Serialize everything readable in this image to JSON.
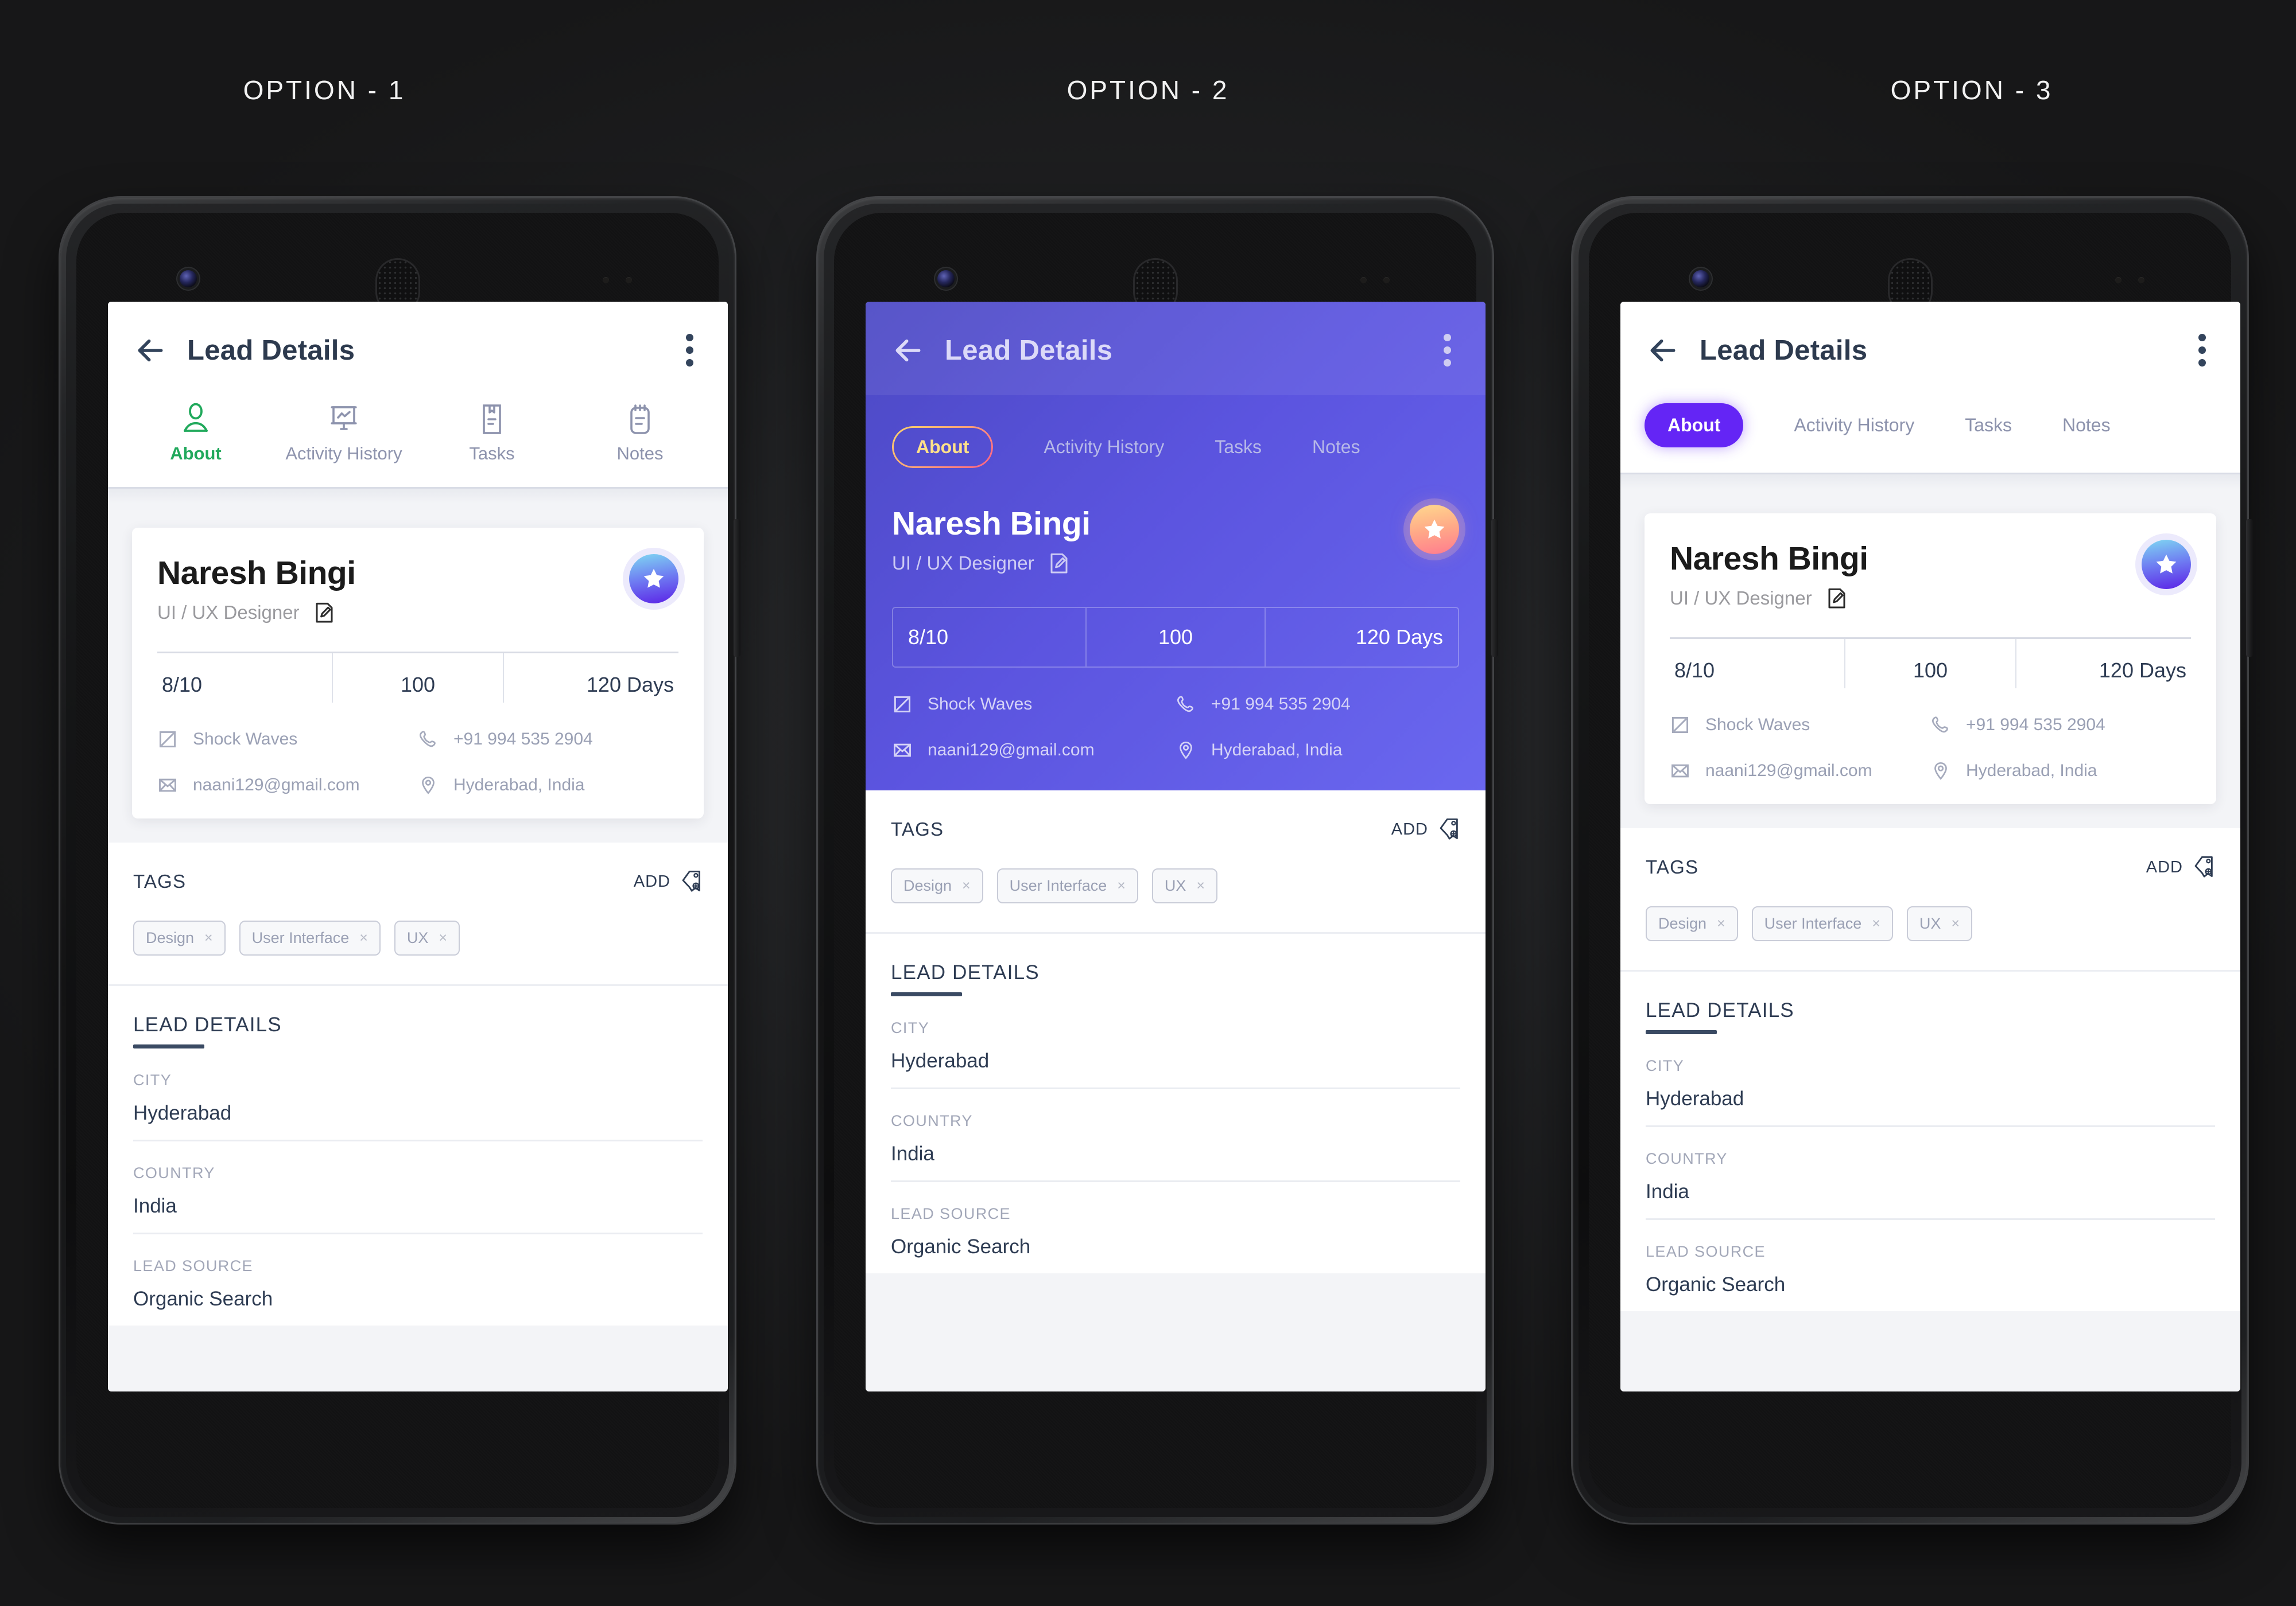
{
  "options": [
    {
      "title": "OPTION - 1"
    },
    {
      "title": "OPTION - 2"
    },
    {
      "title": "OPTION - 3"
    }
  ],
  "app": {
    "title": "Lead Details",
    "back_icon": "arrow-left-icon",
    "overflow_icon": "kebab-menu-icon"
  },
  "tabs": [
    {
      "label": "About",
      "icon": "person-icon",
      "active": true
    },
    {
      "label": "Activity History",
      "icon": "chart-board-icon",
      "active": false
    },
    {
      "label": "Tasks",
      "icon": "task-list-icon",
      "active": false
    },
    {
      "label": "Notes",
      "icon": "notes-icon",
      "active": false
    }
  ],
  "lead": {
    "name": "Naresh Bingi",
    "role": "UI / UX Designer",
    "edit_icon": "edit-pencil-icon",
    "favorite_icon": "star-icon",
    "stats": [
      {
        "value": "8/10"
      },
      {
        "value": "100"
      },
      {
        "value": "120 Days"
      }
    ],
    "contacts": [
      {
        "icon": "company-icon",
        "text": "Shock Waves"
      },
      {
        "icon": "phone-icon",
        "text": "+91 994 535 2904"
      },
      {
        "icon": "email-icon",
        "text": "naani129@gmail.com"
      },
      {
        "icon": "location-icon",
        "text": "Hyderabad, India"
      }
    ]
  },
  "tags": {
    "title": "TAGS",
    "add_label": "ADD",
    "add_icon": "tag-plus-icon",
    "items": [
      {
        "label": "Design",
        "remove_icon": "close-icon"
      },
      {
        "label": "User Interface",
        "remove_icon": "close-icon"
      },
      {
        "label": "UX",
        "remove_icon": "close-icon"
      }
    ]
  },
  "lead_details": {
    "title": "LEAD DETAILS",
    "rows": [
      {
        "key": "CITY",
        "value": "Hyderabad"
      },
      {
        "key": "COUNTRY",
        "value": "India"
      },
      {
        "key": "LEAD SOURCE",
        "value": "Organic Search"
      }
    ]
  },
  "colors": {
    "page_bg": "#1f2022",
    "accent_green": "#21a95c",
    "accent_purple": "#6425f5",
    "hero_purple_start": "#4c49c4",
    "hero_purple_end": "#6a67ef",
    "pill_gradient_start": "#ffd76a",
    "pill_gradient_end": "#ff5f86",
    "text_dark": "#2e3c53",
    "text_muted": "#9aa0b4"
  }
}
